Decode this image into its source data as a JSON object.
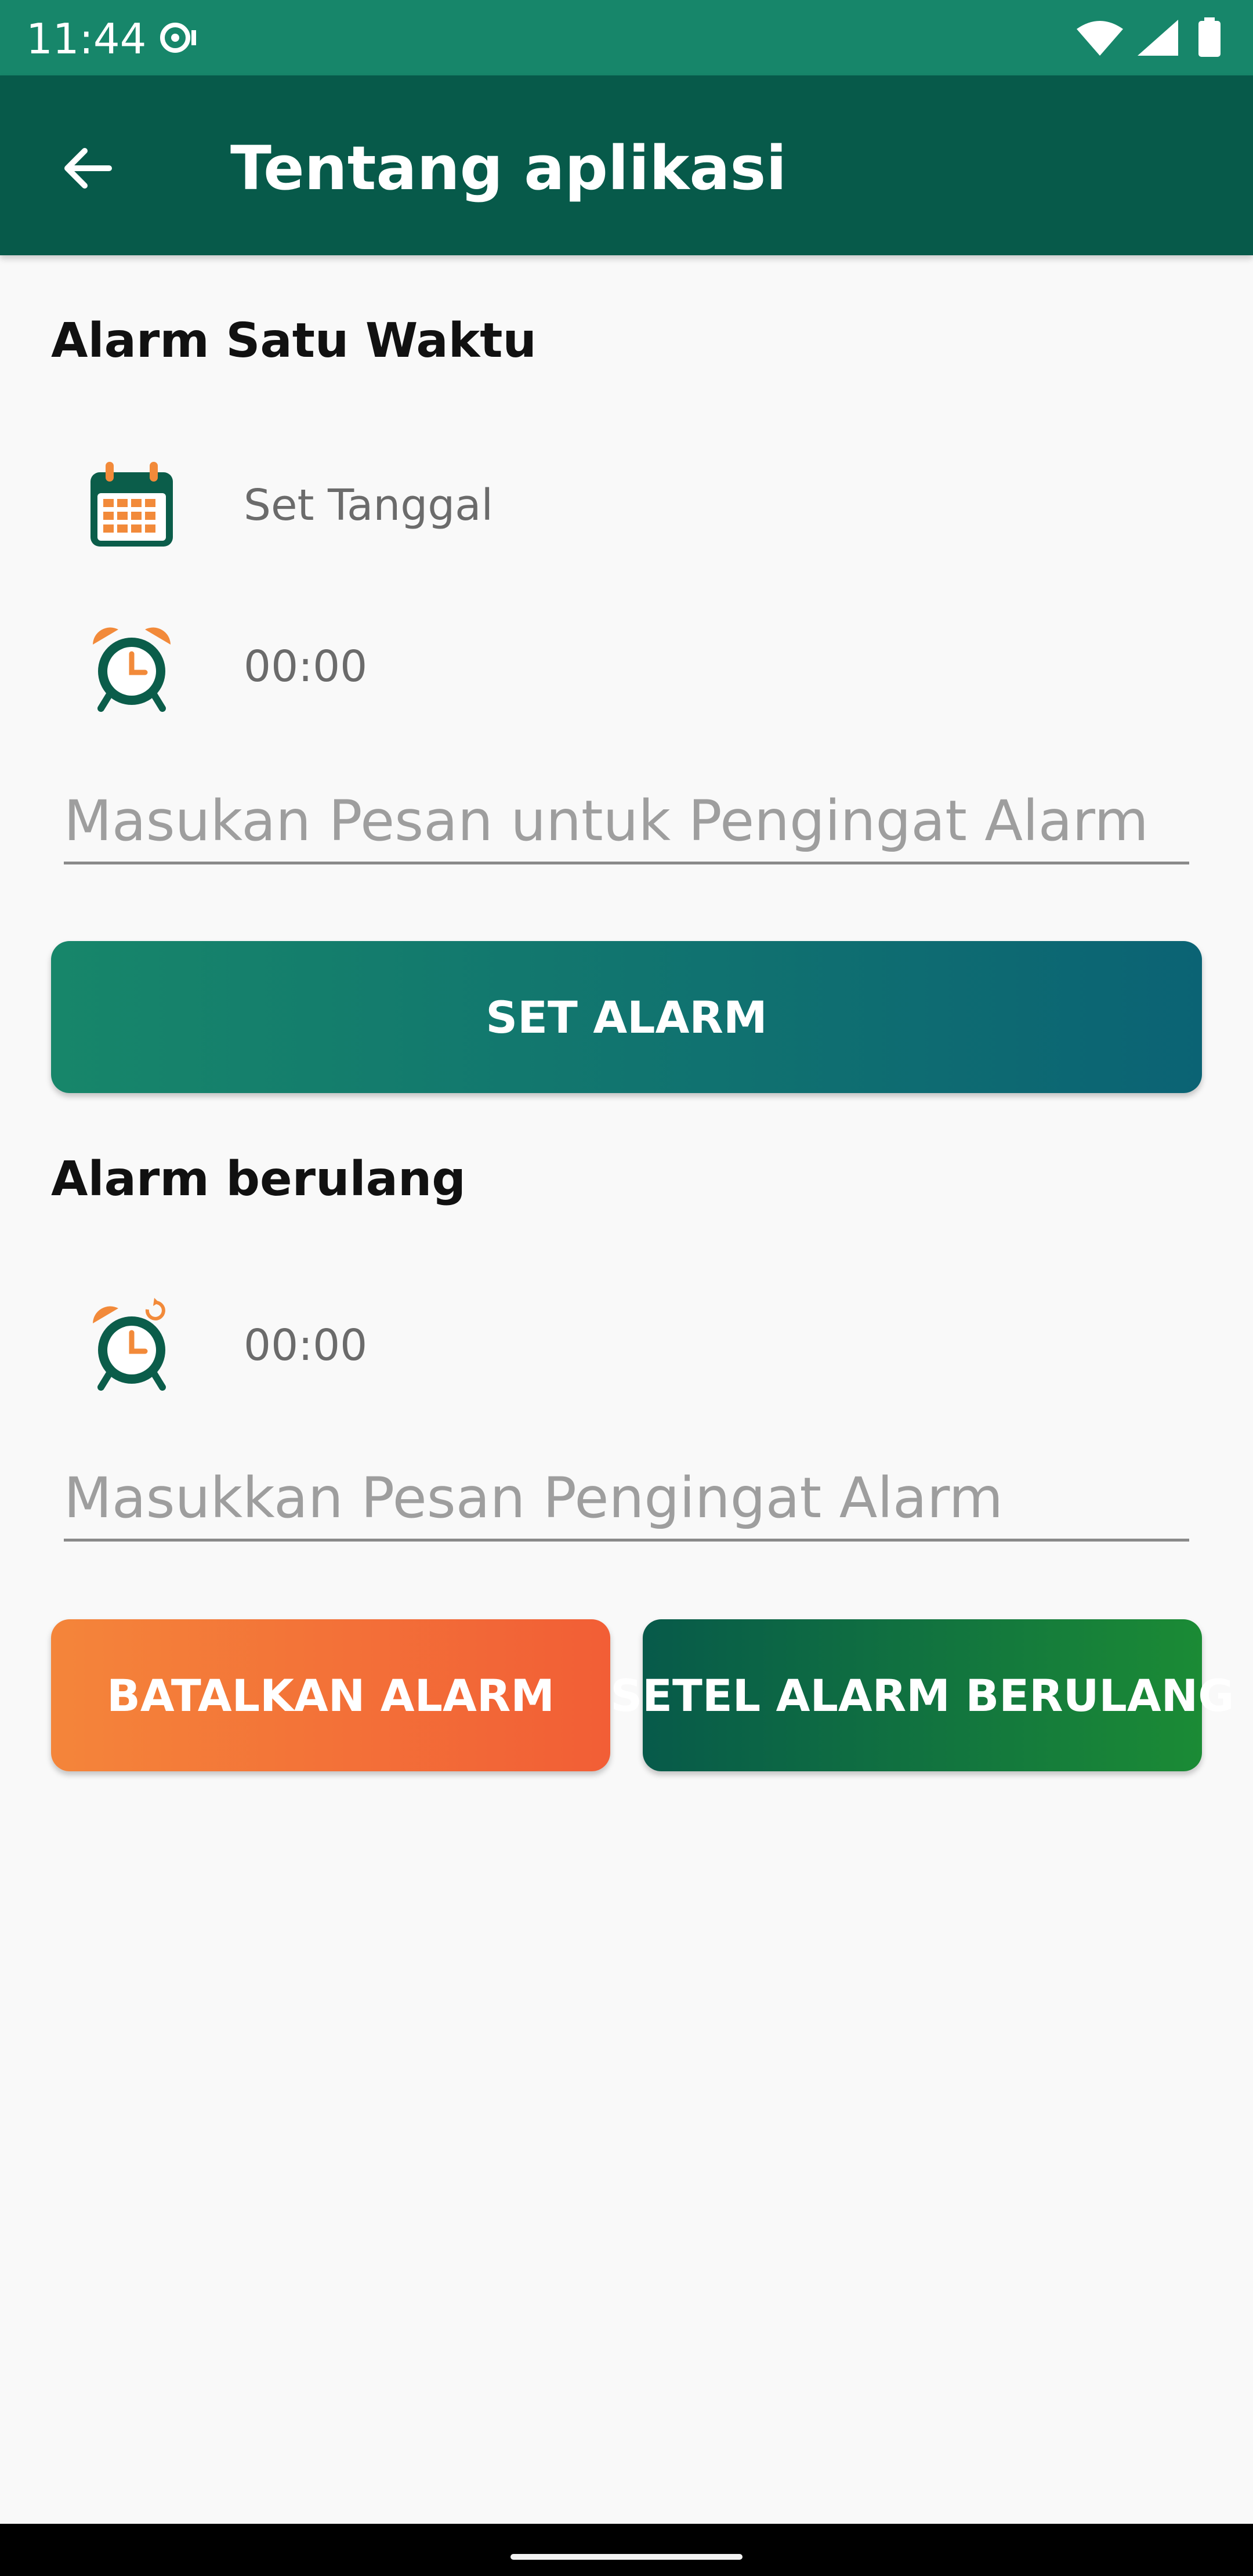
{
  "status_bar": {
    "time": "11:44",
    "icons": [
      "media-icon",
      "wifi-icon",
      "signal-icon",
      "battery-icon"
    ]
  },
  "app_bar": {
    "title": "Tentang aplikasi",
    "back_icon": "arrow-left-icon"
  },
  "one_time_alarm": {
    "title": "Alarm Satu Waktu",
    "date_icon": "calendar-icon",
    "date_label": "Set Tanggal",
    "time_icon": "alarm-clock-icon",
    "time_label": "00:00",
    "message_value": "",
    "message_placeholder": "Masukan Pesan untuk Pengingat Alarm",
    "set_button": "SET ALARM"
  },
  "repeating_alarm": {
    "title": "Alarm berulang",
    "time_icon": "alarm-repeat-icon",
    "time_label": "00:00",
    "message_value": "",
    "message_placeholder": "Masukkan Pesan Pengingat Alarm",
    "cancel_button": "BATALKAN ALARM",
    "repeat_button": "SETEL ALARM BERULANG"
  },
  "colors": {
    "status_bar": "#17866a",
    "app_bar": "#075a4a",
    "accent_orange": "#f28a3a",
    "icon_dark": "#0b5d4a"
  }
}
